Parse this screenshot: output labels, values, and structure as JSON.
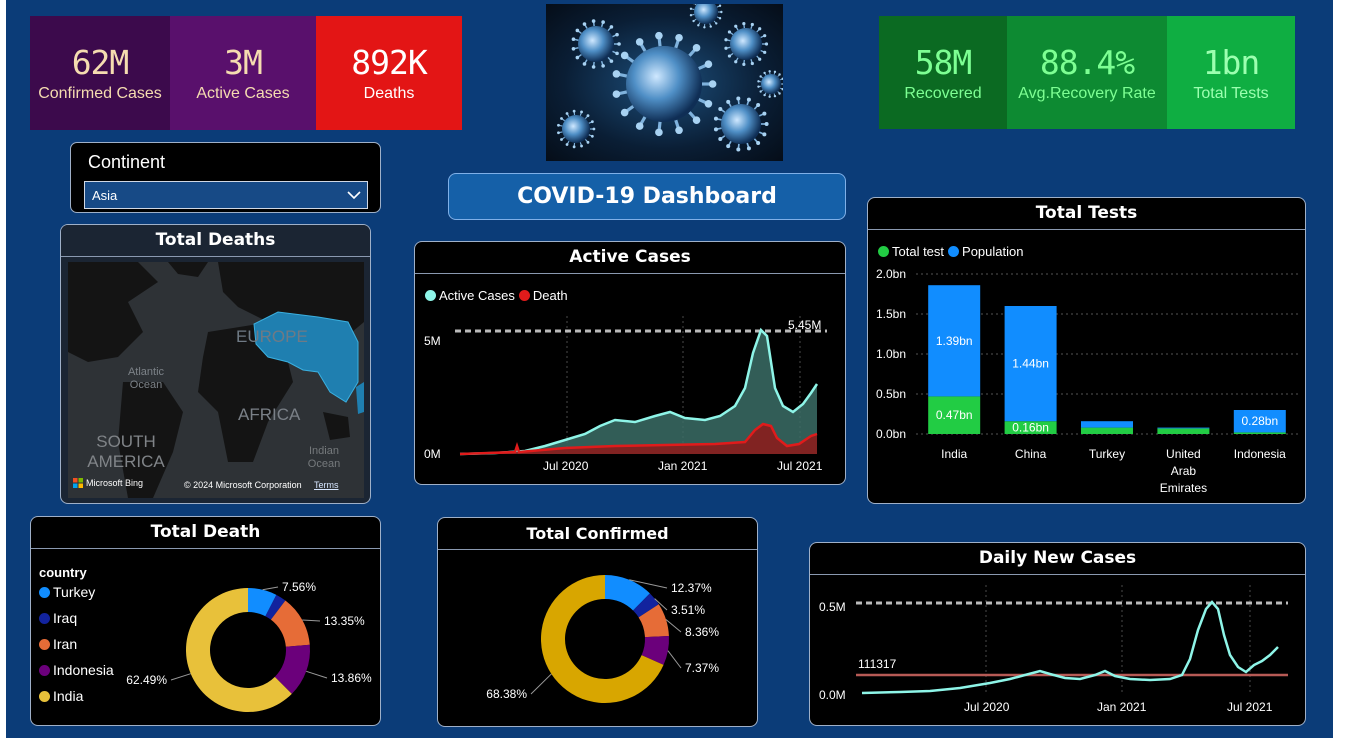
{
  "kpis_left": [
    {
      "value": "62M",
      "label": "Confirmed Cases",
      "bg": "#3c0a4c",
      "color": "#f5dcb0"
    },
    {
      "value": "3M",
      "label": "Active Cases",
      "bg": "#59106c",
      "color": "#f5dcb0"
    },
    {
      "value": "892K",
      "label": "Deaths",
      "bg": "#e31515",
      "color": "#ffffff"
    }
  ],
  "kpis_right": [
    {
      "value": "58M",
      "label": "Recovered",
      "bg": "#0b6a22",
      "color": "#7dff93"
    },
    {
      "value": "88.4%",
      "label": "Avg.Recovery Rate",
      "bg": "#0d8a32",
      "color": "#7dff93"
    },
    {
      "value": "1bn",
      "label": "Total Tests",
      "bg": "#0fae42",
      "color": "#9cffb0"
    }
  ],
  "slicer": {
    "title": "Continent",
    "selected": "Asia"
  },
  "dashboard_title": "COVID-19 Dashboard",
  "map": {
    "title": "Total Deaths",
    "labels": {
      "europe": "EUROPE",
      "atlantic": "Atlantic Ocean",
      "africa": "AFRICA",
      "south_america": "SOUTH AMERICA",
      "indian": "Indian Ocean"
    },
    "attribution_brand": "Microsoft Bing",
    "copyright": "© 2024 Microsoft Corporation",
    "terms": "Terms"
  },
  "active_chart": {
    "title": "Active Cases",
    "legend": [
      {
        "name": "Active Cases",
        "color": "#8ef5e8"
      },
      {
        "name": "Death",
        "color": "#e01b1b"
      }
    ],
    "peak_label": "5.45M",
    "y_ticks": [
      "5M",
      "0M"
    ],
    "x_ticks": [
      "Jul 2020",
      "Jan 2021",
      "Jul 2021"
    ]
  },
  "chart_data": [
    {
      "type": "bar",
      "title": "Total Tests",
      "categories": [
        "India",
        "China",
        "Turkey",
        "United Arab Emirates",
        "Indonesia"
      ],
      "series": [
        {
          "name": "Total test",
          "color": "#22cc44",
          "values": [
            0.47,
            0.16,
            0.08,
            0.07,
            0.02
          ],
          "labels": [
            "0.47bn",
            "0.16bn",
            "",
            "",
            ""
          ]
        },
        {
          "name": "Population",
          "color": "#118dff",
          "values": [
            1.39,
            1.44,
            0.08,
            0.01,
            0.28
          ],
          "labels": [
            "1.39bn",
            "1.44bn",
            "",
            "",
            "0.28bn"
          ]
        }
      ],
      "y_ticks": [
        "2.0bn",
        "1.5bn",
        "1.0bn",
        "0.5bn",
        "0.0bn"
      ],
      "ylim": [
        0,
        2.0
      ],
      "stacked": true,
      "legend_position": "top-left",
      "grid": true
    },
    {
      "type": "pie",
      "title": "Total Death",
      "legend_title": "country",
      "categories": [
        "Turkey",
        "Iraq",
        "Iran",
        "Indonesia",
        "India"
      ],
      "values": [
        7.56,
        2.74,
        13.35,
        13.86,
        62.49
      ],
      "labels": [
        "7.56%",
        "",
        "13.35%",
        "13.86%",
        "62.49%"
      ],
      "colors": [
        "#118dff",
        "#12239e",
        "#e66c37",
        "#6b007b",
        "#e8c13a"
      ],
      "legend_position": "left"
    },
    {
      "type": "pie",
      "title": "Total Confirmed",
      "categories": [
        "Turkey",
        "Iraq",
        "Iran",
        "Indonesia",
        "India"
      ],
      "values": [
        12.37,
        3.51,
        8.36,
        7.37,
        68.38
      ],
      "labels": [
        "12.37%",
        "3.51%",
        "8.36%",
        "7.37%",
        "68.38%"
      ],
      "colors": [
        "#118dff",
        "#12239e",
        "#e66c37",
        "#6b007b",
        "#d8a600"
      ]
    },
    {
      "type": "line",
      "title": "Daily New Cases",
      "average_label": "111317",
      "y_ticks": [
        "0.5M",
        "0.0M"
      ],
      "x_ticks": [
        "Jul 2020",
        "Jan 2021",
        "Jul 2021"
      ]
    }
  ]
}
